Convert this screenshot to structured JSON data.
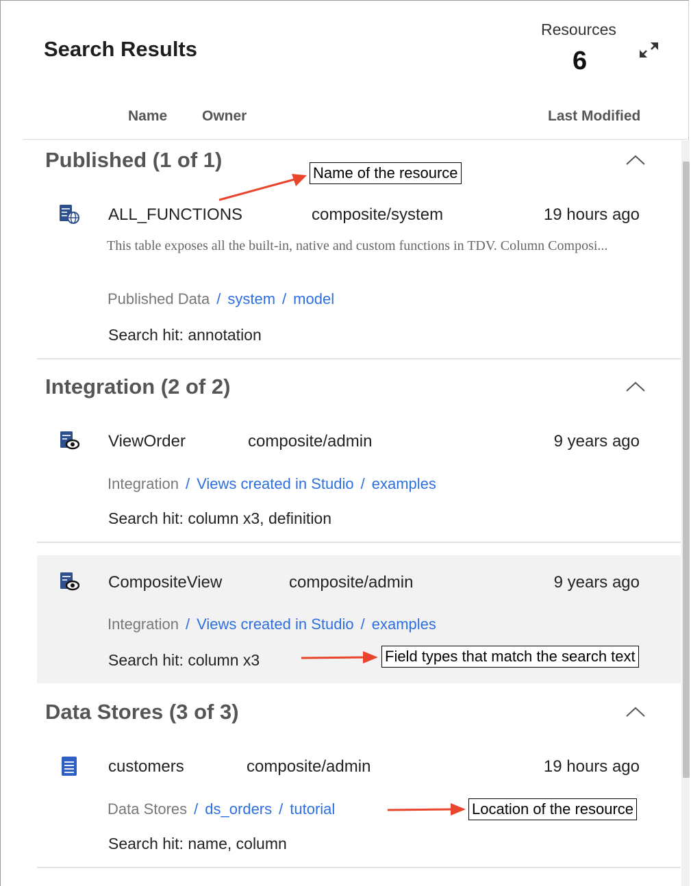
{
  "header": {
    "title": "Search Results",
    "resources_label": "Resources",
    "resources_count": "6"
  },
  "columns": {
    "name": "Name",
    "owner": "Owner",
    "last_modified": "Last Modified"
  },
  "sections": [
    {
      "title": "Published (1 of 1)",
      "items": [
        {
          "name": "ALL_FUNCTIONS",
          "owner": "composite/system",
          "modified": "19 hours ago",
          "description": "This table exposes all the built-in, native and custom functions in TDV. Column Composi...",
          "path": [
            "Published Data",
            "system",
            "model"
          ],
          "hit": "Search hit: annotation",
          "icon": "published-table-icon"
        }
      ]
    },
    {
      "title": "Integration (2 of 2)",
      "items": [
        {
          "name": "ViewOrder",
          "owner": "composite/admin",
          "modified": "9 years ago",
          "path": [
            "Integration",
            "Views created in Studio",
            "examples"
          ],
          "hit": "Search hit: column x3, definition",
          "icon": "view-icon"
        },
        {
          "name": "CompositeView",
          "owner": "composite/admin",
          "modified": "9 years ago",
          "path": [
            "Integration",
            "Views created in Studio",
            "examples"
          ],
          "hit": "Search hit: column x3",
          "icon": "view-icon"
        }
      ]
    },
    {
      "title": "Data Stores (3 of 3)",
      "items": [
        {
          "name": "customers",
          "owner": "composite/admin",
          "modified": "19 hours ago",
          "path": [
            "Data Stores",
            "ds_orders",
            "tutorial"
          ],
          "hit": "Search hit: name, column",
          "icon": "datastore-table-icon"
        }
      ]
    }
  ],
  "callouts": {
    "name": "Name of the resource",
    "field_types": "Field types that match the search text",
    "location": "Location of the resource"
  },
  "colors": {
    "link": "#2d6fe0",
    "arrow": "#e8452c",
    "highlight_row": "#f2f2f2",
    "icon": "#2e4f8c"
  }
}
